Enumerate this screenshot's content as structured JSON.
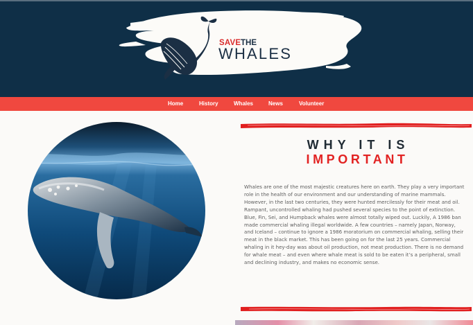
{
  "brand": {
    "logo_save": "SAVE",
    "logo_the": "THE",
    "logo_whales": "WHALES",
    "colors": {
      "header": "#0f2f47",
      "nav": "#f0483f",
      "accent_red": "#e22222",
      "background": "#fbfaf8"
    }
  },
  "nav": {
    "items": [
      {
        "label": "Home",
        "active": true
      },
      {
        "label": "History"
      },
      {
        "label": "Whales"
      },
      {
        "label": "News"
      },
      {
        "label": "Volunteer"
      }
    ]
  },
  "section": {
    "heading_line1": "WHY IT IS",
    "heading_line2": "IMPORTANT",
    "body": "Whales are one of the most majestic creatures here on earth. They play a very important role in the health of our environment and our understanding of marine mammals. However, in the last two centuries, they were hunted mercilessly for their meat and oil. Rampant, uncontrolled whaling had pushed several species to the point of extinction. Blue, Fin, Sei, and Humpback whales were almost totally wiped out. Luckily, A 1986 ban made commercial whaling illegal worldwide. A few countries – namely Japan, Norway, and Iceland – continue to ignore a 1986 moratorium on commercial whaling, selling their meat in the black market. This has been going on for the last 25 years. Commercial whaling in it hey-day was about oil production, not meat production. There is no demand for whale meat – and even where whale meat is sold to be eaten it’s a peripheral, small and declining industry, and makes no economic sense."
  }
}
